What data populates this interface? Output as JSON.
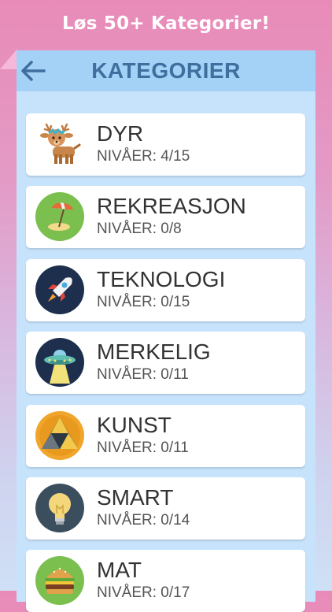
{
  "promo": {
    "text": "Løs 50+ Kategorier!"
  },
  "header": {
    "title": "KATEGORIER",
    "back_icon": "back-arrow-icon"
  },
  "colors": {
    "accent": "#3f6f9e",
    "appbar": "#a4d1f6",
    "panel": "#c7e3fb"
  },
  "categories": [
    {
      "name": "DYR",
      "levels": "NIVÅER: 4/15",
      "icon": "deer-icon"
    },
    {
      "name": "REKREASJON",
      "levels": "NIVÅER: 0/8",
      "icon": "beach-umbrella-icon"
    },
    {
      "name": "TEKNOLOGI",
      "levels": "NIVÅER: 0/15",
      "icon": "rocket-icon"
    },
    {
      "name": "MERKELIG",
      "levels": "NIVÅER: 0/11",
      "icon": "ufo-icon"
    },
    {
      "name": "KUNST",
      "levels": "NIVÅER: 0/11",
      "icon": "triangle-art-icon"
    },
    {
      "name": "SMART",
      "levels": "NIVÅER: 0/14",
      "icon": "lightbulb-icon"
    },
    {
      "name": "MAT",
      "levels": "NIVÅER: 0/17",
      "icon": "burger-icon"
    }
  ]
}
